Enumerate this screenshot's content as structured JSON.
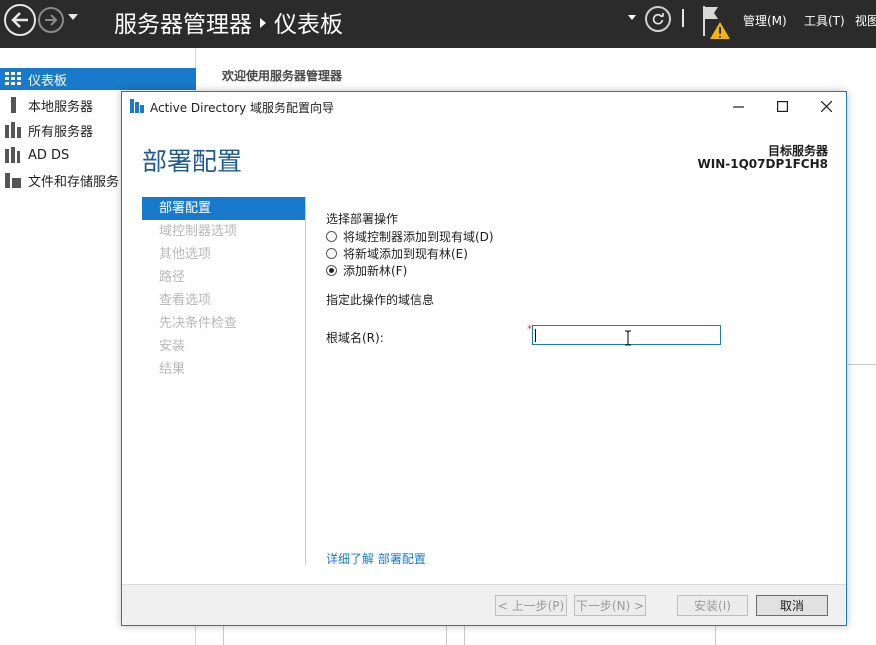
{
  "server_manager": {
    "breadcrumb_root": "服务器管理器",
    "breadcrumb_page": "仪表板",
    "menu": {
      "manage": "管理(M)",
      "tools": "工具(T)",
      "view": "视图"
    },
    "sidebar": [
      {
        "label": "仪表板",
        "active": true
      },
      {
        "label": "本地服务器",
        "active": false
      },
      {
        "label": "所有服务器",
        "active": false
      },
      {
        "label": "AD DS",
        "active": false
      },
      {
        "label": "文件和存储服务",
        "active": false
      }
    ],
    "welcome": "欢迎使用服务器管理器"
  },
  "dialog": {
    "title": "Active Directory 域服务配置向导",
    "heading": "部署配置",
    "target_label": "目标服务器",
    "target_value": "WIN-1Q07DP1FCH8",
    "steps": [
      {
        "label": "部署配置",
        "active": true
      },
      {
        "label": "域控制器选项",
        "active": false
      },
      {
        "label": "其他选项",
        "active": false
      },
      {
        "label": "路径",
        "active": false
      },
      {
        "label": "查看选项",
        "active": false
      },
      {
        "label": "先决条件检查",
        "active": false
      },
      {
        "label": "安装",
        "active": false
      },
      {
        "label": "结果",
        "active": false
      }
    ],
    "operation_label": "选择部署操作",
    "operations": [
      {
        "label": "将域控制器添加到现有域(D)",
        "selected": false
      },
      {
        "label": "将新域添加到现有林(E)",
        "selected": false
      },
      {
        "label": "添加新林(F)",
        "selected": true
      }
    ],
    "domain_info_label": "指定此操作的域信息",
    "root_domain_label": "根域名(R):",
    "root_domain_value": "",
    "required_mark": "*",
    "learn_more": "详细了解 部署配置",
    "buttons": {
      "prev": "< 上一步(P)",
      "next": "下一步(N) >",
      "install": "安装(I)",
      "cancel": "取消"
    }
  },
  "colors": {
    "accent": "#1979ca",
    "topbar": "#2b2b2b",
    "heading": "#1f5b8c",
    "disabled_text": "#b8b8b8",
    "required": "#e0312a"
  }
}
